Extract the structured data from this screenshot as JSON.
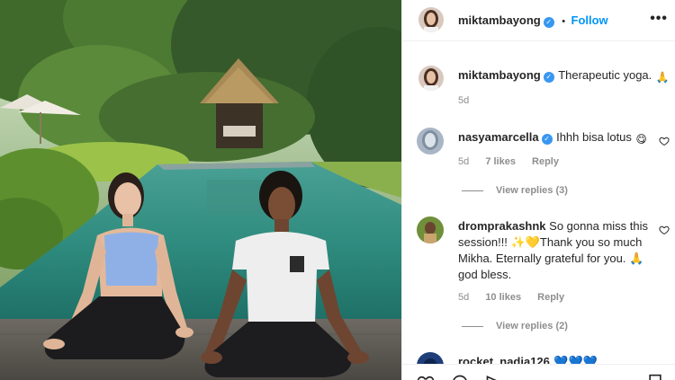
{
  "header": {
    "username": "miktambayong",
    "verified": true,
    "separator": "•",
    "follow_label": "Follow",
    "more_icon": "more-options-icon"
  },
  "caption": {
    "username": "miktambayong",
    "text": "Therapeutic yoga.",
    "emoji": "🙏",
    "time": "5d"
  },
  "comments": [
    {
      "username": "nasyamarcella",
      "verified": true,
      "text": "Ihhh bisa lotus",
      "emoji": "😋",
      "time": "5d",
      "likes": "7 likes",
      "reply_label": "Reply",
      "view_replies": "View replies (3)"
    },
    {
      "username": "dromprakashnk",
      "verified": false,
      "text_lines": [
        "So gonna miss this",
        "session!!! ✨💛Thank you so much",
        "Mikha. Eternally grateful for you. 🙏",
        "god bless."
      ],
      "time": "5d",
      "likes": "10 likes",
      "reply_label": "Reply",
      "view_replies": "View replies (2)"
    },
    {
      "username": "rocket_nadia126",
      "text": "💙💙💙"
    }
  ],
  "colors": {
    "follow": "#0095f6",
    "verified": "#3897f0",
    "meta": "#8e8e8e",
    "text": "#262626"
  }
}
